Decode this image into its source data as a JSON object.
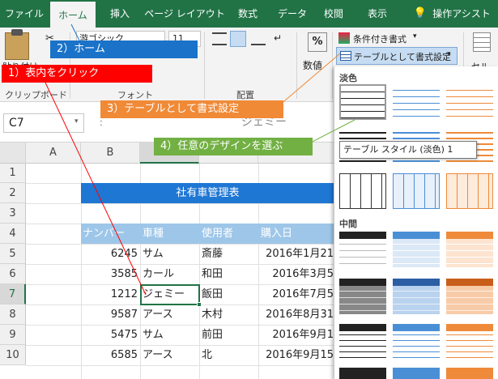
{
  "tabs": [
    "ファイル",
    "ホーム",
    "挿入",
    "ページ レイアウト",
    "数式",
    "データ",
    "校閲",
    "表示",
    "操作アシスト"
  ],
  "ribbon": {
    "paste_label": "貼り付け",
    "clipboard_label": "クリップボード",
    "font_name": "游ゴシック",
    "font_size": "11",
    "font_label": "フォント",
    "align_label": "配置",
    "number_label": "数値",
    "percent": "%",
    "cond_format": "条件付き書式",
    "table_format": "テーブルとして書式設定",
    "cell_label": "セル"
  },
  "formula": {
    "name_box": "C7",
    "content": "ジェミー"
  },
  "columns": [
    "A",
    "B",
    "C",
    "D",
    "E"
  ],
  "rows": [
    "1",
    "2",
    "3",
    "4",
    "5",
    "6",
    "7",
    "8",
    "9",
    "10"
  ],
  "sheet": {
    "title": "社有車管理表",
    "headers": [
      "ナンバー",
      "車種",
      "使用者",
      "購入日"
    ],
    "data": [
      [
        "6245",
        "サム",
        "斎藤",
        "2016年1月21"
      ],
      [
        "3585",
        "カール",
        "和田",
        "2016年3月5"
      ],
      [
        "1212",
        "ジェミー",
        "飯田",
        "2016年7月5"
      ],
      [
        "9587",
        "アース",
        "木村",
        "2016年8月31"
      ],
      [
        "5475",
        "サム",
        "前田",
        "2016年9月1"
      ],
      [
        "6585",
        "アース",
        "北",
        "2016年9月15"
      ]
    ]
  },
  "callouts": [
    "1）表内をクリック",
    "2）ホーム",
    "3）テーブルとして書式設定",
    "4）任意のデザインを選ぶ"
  ],
  "gallery": {
    "light": "淡色",
    "medium": "中間",
    "tooltip": "テーブル スタイル (淡色) 1"
  },
  "colors": {
    "excel_green": "#217346",
    "title_blue": "#1f77d4",
    "header_blue": "#9ec6e8",
    "callout_red": "#ff0000",
    "callout_blue": "#1a73c8",
    "callout_orange": "#f08a37",
    "callout_green": "#72b043"
  }
}
